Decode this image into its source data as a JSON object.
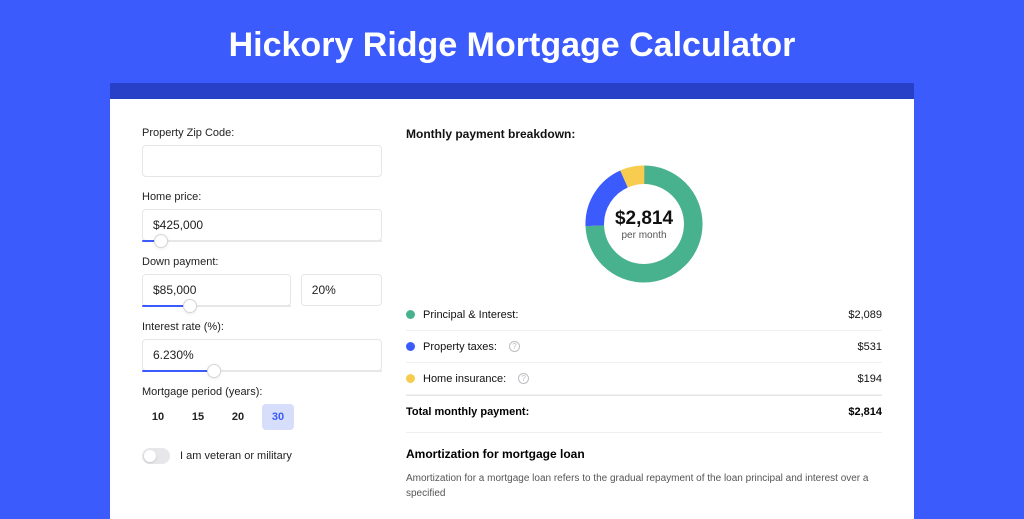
{
  "page_title": "Hickory Ridge Mortgage Calculator",
  "colors": {
    "page_bg": "#3b5bfd",
    "inner_bg": "#2740c7",
    "principal": "#48b18d",
    "taxes": "#3b5bfd",
    "insurance": "#f7cc4f"
  },
  "form": {
    "zip_label": "Property Zip Code:",
    "zip_value": "",
    "home_price_label": "Home price:",
    "home_price_value": "$425,000",
    "home_price_slider_pct": 8,
    "down_payment_label": "Down payment:",
    "down_payment_amount": "$85,000",
    "down_payment_pct": "20%",
    "down_payment_slider_pct": 20,
    "interest_label": "Interest rate (%):",
    "interest_value": "6.230%",
    "interest_slider_pct": 30,
    "period_label": "Mortgage period (years):",
    "period_options": [
      "10",
      "15",
      "20",
      "30"
    ],
    "period_selected": "30",
    "veteran_label": "I am veteran or military"
  },
  "breakdown": {
    "title": "Monthly payment breakdown:",
    "donut_amount": "$2,814",
    "donut_sub": "per month",
    "items": {
      "principal": {
        "label": "Principal & Interest:",
        "value": "$2,089"
      },
      "taxes": {
        "label": "Property taxes:",
        "value": "$531"
      },
      "insurance": {
        "label": "Home insurance:",
        "value": "$194"
      }
    },
    "total_label": "Total monthly payment:",
    "total_value": "$2,814"
  },
  "chart_data": {
    "type": "pie",
    "title": "Monthly payment breakdown",
    "series": [
      {
        "name": "Principal & Interest",
        "value": 2089,
        "color": "#48b18d"
      },
      {
        "name": "Property taxes",
        "value": 531,
        "color": "#3b5bfd"
      },
      {
        "name": "Home insurance",
        "value": 194,
        "color": "#f7cc4f"
      }
    ],
    "total": 2814
  },
  "amortization": {
    "title": "Amortization for mortgage loan",
    "text": "Amortization for a mortgage loan refers to the gradual repayment of the loan principal and interest over a specified"
  }
}
